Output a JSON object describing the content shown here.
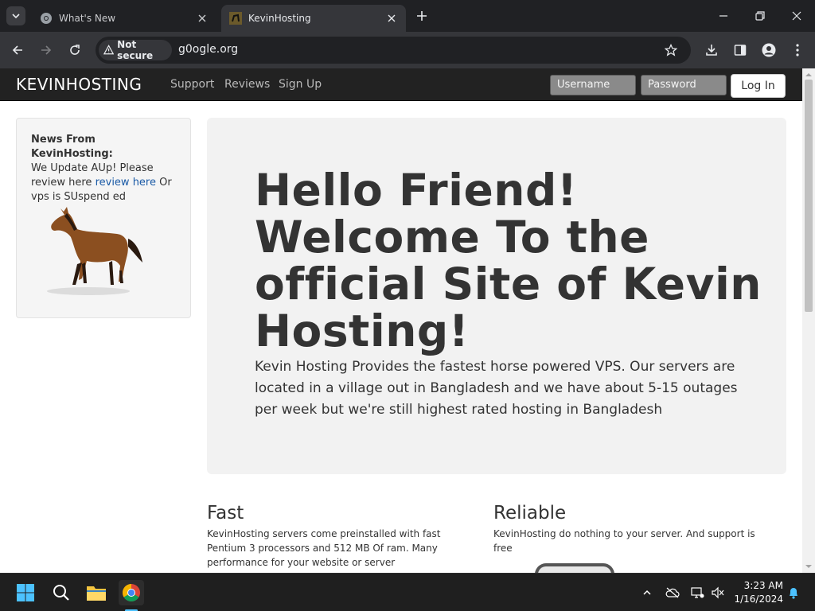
{
  "browser": {
    "tabs": [
      {
        "title": "What's New",
        "favicon": "chrome-icon"
      },
      {
        "title": "KevinHosting",
        "favicon": "site-favicon"
      }
    ],
    "security_chip": "Not secure",
    "url": "g0ogle.org"
  },
  "site": {
    "brand": "KEVINHOSTING",
    "nav": [
      "Support",
      "Reviews",
      "Sign Up"
    ],
    "username_placeholder": "Username",
    "password_placeholder": "Password",
    "login_label": "Log In",
    "news": {
      "heading": "News From KevinHosting:",
      "text_before": "We Update AUp! Please review here ",
      "link": "review here",
      "text_after": " Or vps is SUspend ed"
    },
    "hero": {
      "title": "Hello Friend! Welcome To the official Site of Kevin Hosting!",
      "body": "Kevin Hosting Provides the fastest horse powered VPS. Our servers are located in a village out in Bangladesh and we have about 5-15 outages per week but we're still highest rated hosting in Bangladesh"
    },
    "features": [
      {
        "title": "Fast",
        "text": "KevinHosting servers come preinstalled with fast Pentium 3 processors and 512 MB Of ram. Many performance for your website or server"
      },
      {
        "title": "Reliable",
        "text": "KevinHosting do nothing to your server. And support is free"
      }
    ]
  },
  "taskbar": {
    "time": "3:23 AM",
    "date": "1/16/2024"
  },
  "colors": {
    "navbar": "#222222",
    "jumbotron": "#f2f2f2",
    "link": "#1a5aa6",
    "taskbar_accent": "#4cc2ff"
  }
}
